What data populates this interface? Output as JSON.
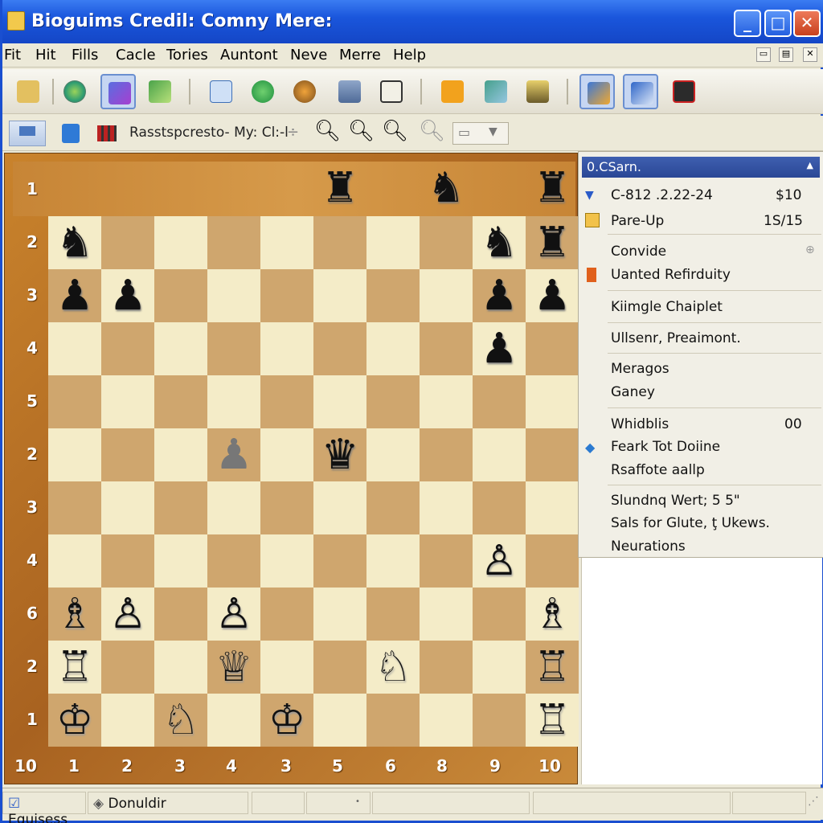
{
  "window": {
    "title": "Bioguims Credil: Comny Mere:"
  },
  "menu": [
    "Fit",
    "Hit",
    "Fills",
    "Cacle",
    "Tories",
    "Auntont",
    "Neve",
    "Merre",
    "Help"
  ],
  "toolbar2": {
    "label": "Rasstspcresto- My: Cl:-l"
  },
  "board": {
    "rank_labels": [
      "1",
      "2",
      "3",
      "4",
      "5",
      "2",
      "3",
      "4",
      "6",
      "2",
      "1"
    ],
    "file_labels": [
      "10",
      "1",
      "2",
      "3",
      "4",
      "3",
      "5",
      "6",
      "8",
      "9",
      "10"
    ],
    "top_pieces": [
      {
        "col": 5,
        "glyph": "♜",
        "color": "black"
      },
      {
        "col": 7,
        "glyph": "♞",
        "color": "black"
      },
      {
        "col": 9,
        "glyph": "♜",
        "color": "black"
      }
    ],
    "pieces": [
      {
        "row": 0,
        "col": 0,
        "glyph": "♞",
        "color": "black"
      },
      {
        "row": 0,
        "col": 8,
        "glyph": "♞",
        "color": "black"
      },
      {
        "row": 0,
        "col": 9,
        "glyph": "♜",
        "color": "black"
      },
      {
        "row": 1,
        "col": 0,
        "glyph": "♟",
        "color": "black"
      },
      {
        "row": 1,
        "col": 1,
        "glyph": "♟",
        "color": "black"
      },
      {
        "row": 1,
        "col": 8,
        "glyph": "♟",
        "color": "black"
      },
      {
        "row": 1,
        "col": 9,
        "glyph": "♟",
        "color": "black"
      },
      {
        "row": 2,
        "col": 8,
        "glyph": "♟",
        "color": "black"
      },
      {
        "row": 4,
        "col": 3,
        "glyph": "♟",
        "color": "grey"
      },
      {
        "row": 4,
        "col": 5,
        "glyph": "♛",
        "color": "black"
      },
      {
        "row": 6,
        "col": 8,
        "glyph": "♙",
        "color": "white"
      },
      {
        "row": 7,
        "col": 0,
        "glyph": "♗",
        "color": "white"
      },
      {
        "row": 7,
        "col": 1,
        "glyph": "♙",
        "color": "white"
      },
      {
        "row": 7,
        "col": 3,
        "glyph": "♙",
        "color": "white"
      },
      {
        "row": 7,
        "col": 9,
        "glyph": "♗",
        "color": "white"
      },
      {
        "row": 8,
        "col": 0,
        "glyph": "♖",
        "color": "white"
      },
      {
        "row": 8,
        "col": 3,
        "glyph": "♕",
        "color": "white"
      },
      {
        "row": 8,
        "col": 6,
        "glyph": "♘",
        "color": "white"
      },
      {
        "row": 8,
        "col": 9,
        "glyph": "♖",
        "color": "white"
      },
      {
        "row": 9,
        "col": 0,
        "glyph": "♔",
        "color": "white"
      },
      {
        "row": 9,
        "col": 2,
        "glyph": "♘",
        "color": "white"
      },
      {
        "row": 9,
        "col": 4,
        "glyph": "♔",
        "color": "white"
      },
      {
        "row": 9,
        "col": 9,
        "glyph": "♖",
        "color": "white"
      }
    ]
  },
  "panel": {
    "header": "0.CSarn.",
    "rows": [
      {
        "label": "C-812 .2.22-24",
        "value": "$10"
      },
      {
        "label": "Pare-Up",
        "value": "1S/15"
      },
      {
        "label": "Convide",
        "value": ""
      },
      {
        "label": "Uanted Refirduity",
        "value": ""
      },
      {
        "label": "Kiimgle Chaiplet",
        "value": ""
      },
      {
        "label": "Ullsenr, Preaimont.",
        "value": ""
      },
      {
        "label": "Meragos",
        "value": ""
      },
      {
        "label": "Ganey",
        "value": ""
      },
      {
        "label": "Whidblis",
        "value": "00"
      },
      {
        "label": "Feark Tot Doiine",
        "value": ""
      },
      {
        "label": "Rsaffote aallp",
        "value": ""
      },
      {
        "label": "Slundnq Wert; 5 5\"",
        "value": ""
      },
      {
        "label": "Sals for Glute, ţ Ukews.",
        "value": ""
      },
      {
        "label": "Neurations",
        "value": ""
      }
    ]
  },
  "status": {
    "left": "Equisess",
    "mid": "Donuldir"
  }
}
